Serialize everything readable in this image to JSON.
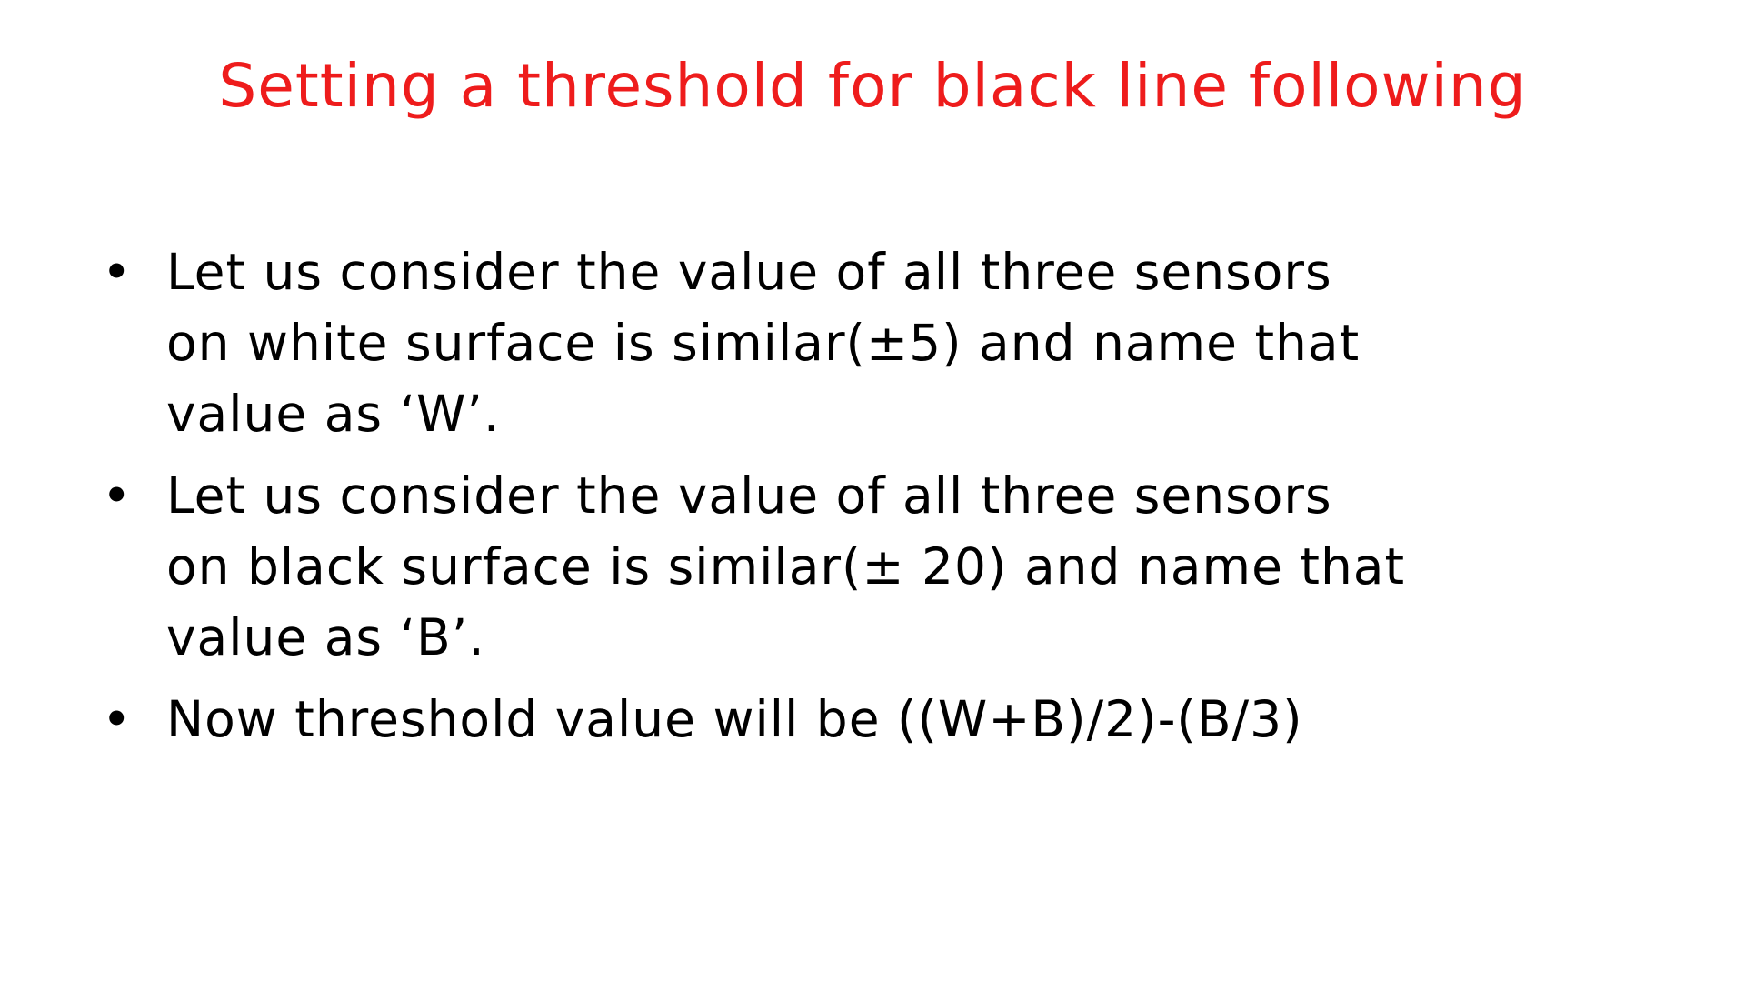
{
  "title": "Setting a threshold for black line following",
  "colors": {
    "title": "#ee1c1c",
    "body_text": "#000000",
    "background": "#ffffff"
  },
  "bullets": [
    {
      "lines": [
        "Let us consider the value of all three sensors",
        "on white surface is similar(±5) and name that",
        "value as ‘W’."
      ]
    },
    {
      "lines": [
        "Let us consider the value of all three sensors",
        "on black surface is similar(± 20) and name that",
        "value as ‘B’."
      ]
    },
    {
      "lines": [
        "Now threshold value will be ((W+B)/2)-(B/3)"
      ]
    }
  ],
  "bullet_symbol": "•"
}
